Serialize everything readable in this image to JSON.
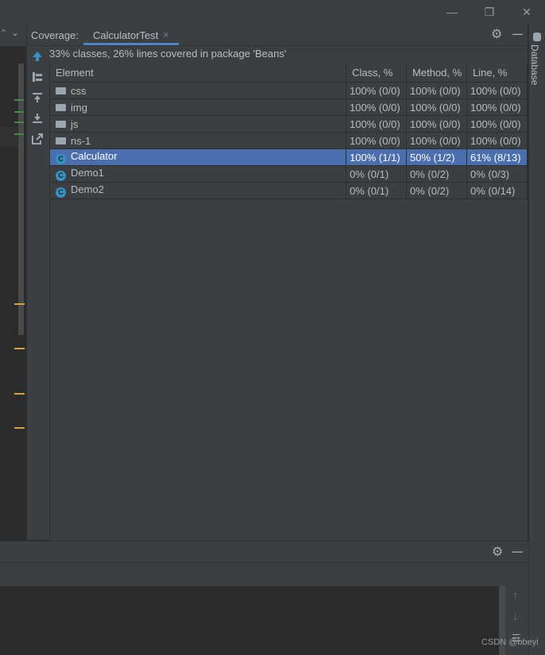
{
  "coverage": {
    "label": "Coverage:",
    "tab_title": "CalculatorTest",
    "summary": "33% classes, 26% lines covered in package 'Beans'"
  },
  "table": {
    "headers": [
      "Element",
      "Class, %",
      "Method, %",
      "Line, %"
    ],
    "rows": [
      {
        "type": "folder",
        "name": "css",
        "class": "100% (0/0)",
        "method": "100% (0/0)",
        "line": "100% (0/0)"
      },
      {
        "type": "folder",
        "name": "img",
        "class": "100% (0/0)",
        "method": "100% (0/0)",
        "line": "100% (0/0)"
      },
      {
        "type": "folder",
        "name": "js",
        "class": "100% (0/0)",
        "method": "100% (0/0)",
        "line": "100% (0/0)"
      },
      {
        "type": "folder",
        "name": "ns-1",
        "class": "100% (0/0)",
        "method": "100% (0/0)",
        "line": "100% (0/0)"
      },
      {
        "type": "class",
        "name": "Calculator",
        "class": "100% (1/1)",
        "method": "50% (1/2)",
        "line": "61% (8/13)",
        "selected": true
      },
      {
        "type": "class",
        "name": "Demo1",
        "class": "0% (0/1)",
        "method": "0% (0/2)",
        "line": "0% (0/3)"
      },
      {
        "type": "class",
        "name": "Demo2",
        "class": "0% (0/1)",
        "method": "0% (0/2)",
        "line": "0% (0/14)"
      }
    ]
  },
  "right_stripe": {
    "database_label": "Database"
  },
  "watermark": "CSDN @bbeyi",
  "icons": {
    "class_glyph": "C",
    "close_tab": "×",
    "minimize": "—",
    "restore": "❐",
    "close_window": "✕",
    "gear": "⚙",
    "hide": "—",
    "chevron": "⌄",
    "arrow_up": "↑",
    "arrow_down": "↓"
  },
  "colors": {
    "selection": "#4b6eaf",
    "accent": "#3592c4",
    "marker": "#d4a33c"
  }
}
